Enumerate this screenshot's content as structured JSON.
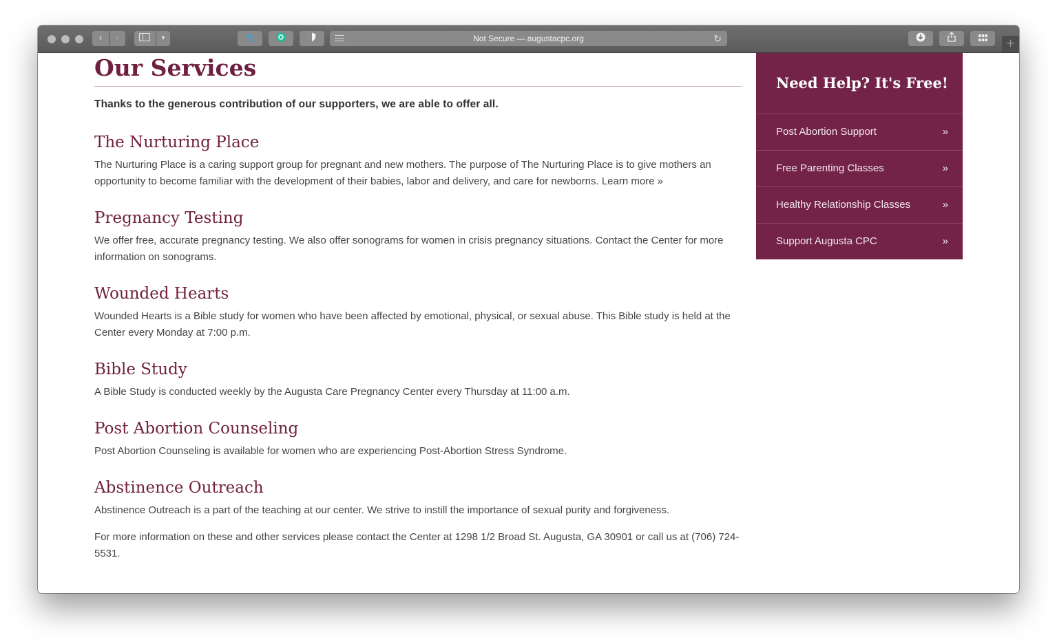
{
  "browser": {
    "address_text": "Not Secure — augustacpc.org",
    "new_tab_label": "+"
  },
  "page": {
    "title": "Our Services",
    "intro": "Thanks to the generous contribution of our supporters, we are able to offer all.",
    "services": [
      {
        "heading": "The Nurturing Place",
        "text": "The Nurturing Place is a caring support group for pregnant and new mothers. The purpose of The Nurturing Place is to give mothers an opportunity to become familiar with the development of their babies, labor and delivery, and care for newborns.",
        "link": "Learn more »"
      },
      {
        "heading": "Pregnancy Testing",
        "text": "We offer free, accurate pregnancy testing. We also offer sonograms for women in crisis pregnancy situations. Contact the Center for more information on sonograms."
      },
      {
        "heading": "Wounded Hearts",
        "text": "Wounded Hearts is a Bible study for women who have been affected by emotional, physical, or sexual abuse. This Bible study is held at the Center every Monday at 7:00 p.m."
      },
      {
        "heading": "Bible Study",
        "text": "A Bible Study is conducted weekly by the Augusta Care Pregnancy Center every Thursday at 11:00 a.m."
      },
      {
        "heading": "Post Abortion Counseling",
        "text": "Post Abortion Counseling is available for women who are experiencing Post-Abortion Stress Syndrome."
      },
      {
        "heading": "Abstinence Outreach",
        "text": "Abstinence Outreach is a part of the teaching at our center. We strive to instill the importance of sexual purity and forgiveness."
      }
    ],
    "footer_note": "For more information on these and other services please contact the Center at 1298 1/2 Broad St. Augusta, GA 30901 or call us at (706) 724-5531."
  },
  "sidebar": {
    "title": "Need Help? It's Free!",
    "chevron": "»",
    "items": [
      {
        "label": "Post Abortion Support"
      },
      {
        "label": "Free Parenting Classes"
      },
      {
        "label": "Healthy Relationship Classes"
      },
      {
        "label": "Support Augusta CPC"
      }
    ]
  },
  "colors": {
    "brand": "#722347",
    "heading": "#70203f",
    "body_text": "#444444"
  }
}
